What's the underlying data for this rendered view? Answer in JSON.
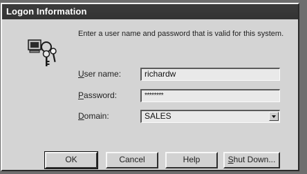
{
  "window": {
    "title": "Logon Information"
  },
  "instructions": "Enter a user name and password that is valid for this system.",
  "fields": {
    "user_name": {
      "label_ul": "U",
      "label_rest": "ser name:",
      "value": "richardw"
    },
    "password": {
      "label_ul": "P",
      "label_rest": "assword:",
      "value": "********"
    },
    "domain": {
      "label_ul": "D",
      "label_rest": "omain:",
      "value": "SALES"
    }
  },
  "buttons": {
    "ok": "OK",
    "cancel": "Cancel",
    "help": "Help",
    "shutdown_ul": "S",
    "shutdown_rest": "hut Down..."
  },
  "icons": {
    "logon": "logon-keys-icon"
  }
}
